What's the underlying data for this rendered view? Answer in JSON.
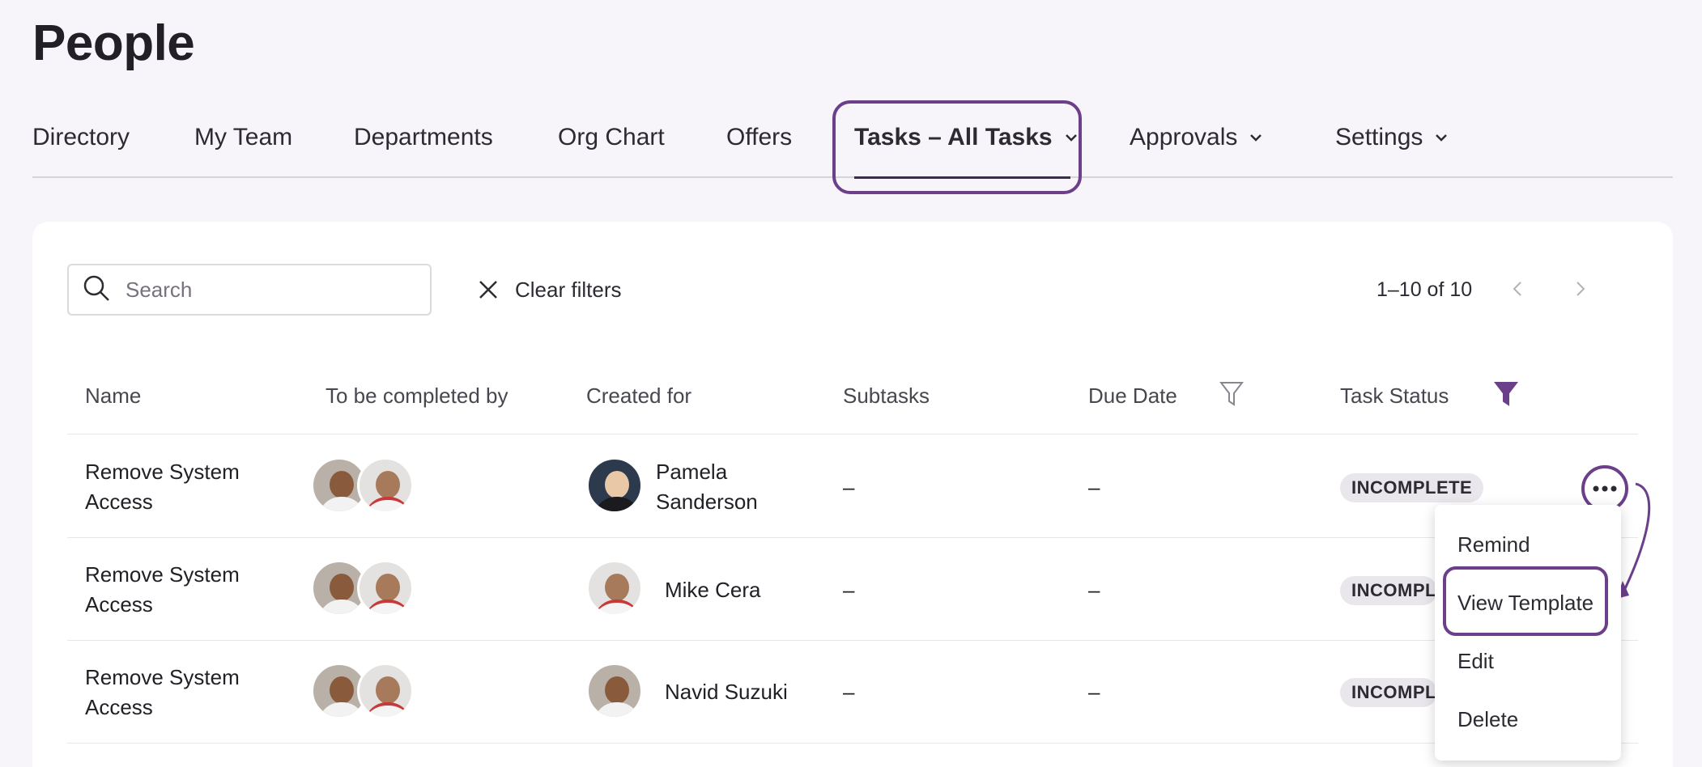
{
  "page": {
    "title": "People"
  },
  "tabs": [
    {
      "label": "Directory",
      "has_dropdown": false
    },
    {
      "label": "My Team",
      "has_dropdown": false
    },
    {
      "label": "Departments",
      "has_dropdown": false
    },
    {
      "label": "Org Chart",
      "has_dropdown": false
    },
    {
      "label": "Offers",
      "has_dropdown": false
    },
    {
      "label": "Tasks – All Tasks",
      "has_dropdown": true,
      "active": true
    },
    {
      "label": "Approvals",
      "has_dropdown": true
    },
    {
      "label": "Settings",
      "has_dropdown": true
    }
  ],
  "toolbar": {
    "search_placeholder": "Search",
    "clear_filters_label": "Clear filters",
    "pagination_text": "1–10 of 10"
  },
  "table": {
    "columns": [
      "Name",
      "To be completed by",
      "Created for",
      "Subtasks",
      "Due Date",
      "Task Status"
    ],
    "rows": [
      {
        "name_line1": "Remove System",
        "name_line2": "Access",
        "created_for_line1": "Pamela",
        "created_for_line2": "Sanderson",
        "subtasks": "–",
        "due_date": "–",
        "status": "INCOMPLETE"
      },
      {
        "name_line1": "Remove System",
        "name_line2": "Access",
        "created_for_line1": "Mike Cera",
        "created_for_line2": "",
        "subtasks": "–",
        "due_date": "–",
        "status": "INCOMPLETE"
      },
      {
        "name_line1": "Remove System",
        "name_line2": "Access",
        "created_for_line1": "Navid Suzuki",
        "created_for_line2": "",
        "subtasks": "–",
        "due_date": "–",
        "status": "INCOMPLETE"
      }
    ]
  },
  "row_menu": {
    "items": [
      "Remind",
      "View Template",
      "Edit",
      "Delete"
    ]
  },
  "colors": {
    "accent": "#6b3f8a",
    "background": "#f7f5fa",
    "badge_bg": "#e9e6ec"
  }
}
